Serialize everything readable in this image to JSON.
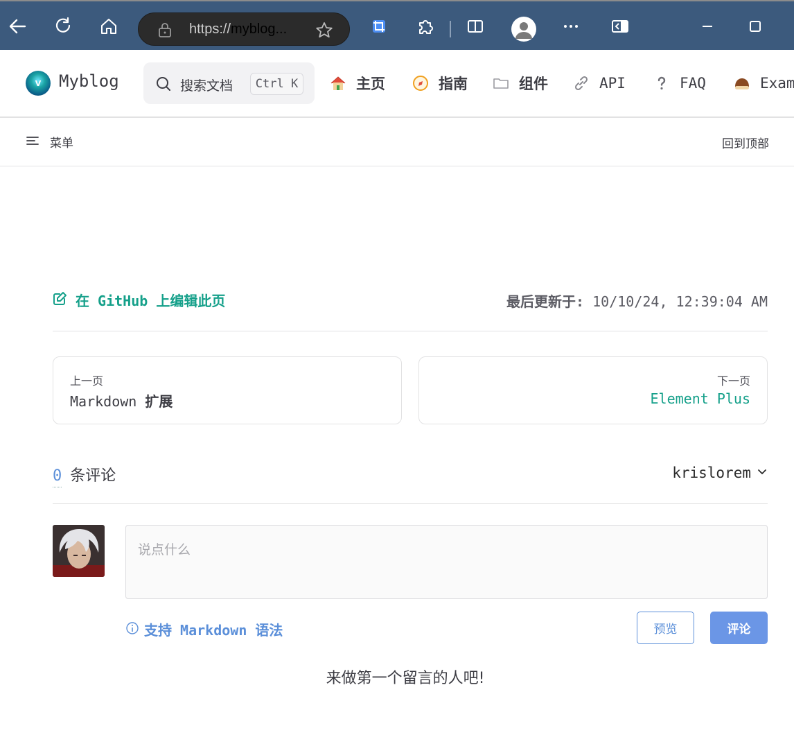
{
  "browser": {
    "url_prefix": "https://",
    "url_host": "myblog...",
    "icons": [
      "back-icon",
      "refresh-icon",
      "home-icon",
      "lock-icon",
      "favorite-star-icon",
      "screenshot-icon",
      "extensions-icon",
      "split-screen-icon",
      "profile-icon",
      "more-icon",
      "sidebar-icon",
      "minimize-icon",
      "maximize-icon"
    ]
  },
  "navbar": {
    "site_title": "Myblog",
    "search_placeholder": "搜索文档",
    "search_shortcut": "Ctrl K",
    "items": [
      {
        "label": "主页",
        "icon": "house-icon"
      },
      {
        "label": "指南",
        "icon": "compass-icon"
      },
      {
        "label": "组件",
        "icon": "folder-icon"
      },
      {
        "label": "API",
        "icon": "link-icon"
      },
      {
        "label": "FAQ",
        "icon": "question-icon"
      },
      {
        "label": "Exam",
        "icon": "chestnut-icon"
      }
    ]
  },
  "subbar": {
    "menu_label": "菜单",
    "to_top_label": "回到顶部"
  },
  "doc_footer": {
    "edit_link": "在 GitHub 上编辑此页",
    "last_updated_label": "最后更新于:",
    "last_updated_value": "10/10/24, 12:39:04 AM"
  },
  "pager": {
    "prev_desc": "上一页",
    "prev_title_en": "Markdown",
    "prev_title_cn": "扩展",
    "next_desc": "下一页",
    "next_title": "Element Plus"
  },
  "comments": {
    "count": "0",
    "count_label": "条评论",
    "username": "krislorem",
    "input_placeholder": "说点什么",
    "markdown_hint": "支持 Markdown 语法",
    "preview_button": "预览",
    "submit_button": "评论",
    "empty_message": "来做第一个留言的人吧!"
  },
  "colors": {
    "brand": "#15a08a",
    "link_blue": "#5b8fd9",
    "chrome_bar": "#3c5a7d"
  }
}
